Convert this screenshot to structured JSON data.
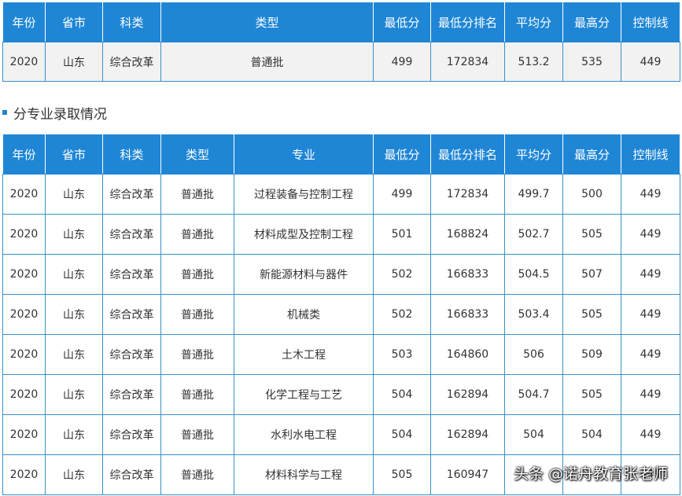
{
  "summary": {
    "headers": [
      "年份",
      "省市",
      "科类",
      "类型",
      "最低分",
      "最低分排名",
      "平均分",
      "最高分",
      "控制线"
    ],
    "row": [
      "2020",
      "山东",
      "综合改革",
      "普通批",
      "499",
      "172834",
      "513.2",
      "535",
      "449"
    ]
  },
  "section_title": "分专业录取情况",
  "majors": {
    "headers": [
      "年份",
      "省市",
      "科类",
      "类型",
      "专业",
      "最低分",
      "最低分排名",
      "平均分",
      "最高分",
      "控制线"
    ],
    "rows": [
      [
        "2020",
        "山东",
        "综合改革",
        "普通批",
        "过程装备与控制工程",
        "499",
        "172834",
        "499.7",
        "500",
        "449"
      ],
      [
        "2020",
        "山东",
        "综合改革",
        "普通批",
        "材料成型及控制工程",
        "501",
        "168824",
        "502.7",
        "505",
        "449"
      ],
      [
        "2020",
        "山东",
        "综合改革",
        "普通批",
        "新能源材料与器件",
        "502",
        "166833",
        "504.5",
        "507",
        "449"
      ],
      [
        "2020",
        "山东",
        "综合改革",
        "普通批",
        "机械类",
        "502",
        "166833",
        "503.4",
        "505",
        "449"
      ],
      [
        "2020",
        "山东",
        "综合改革",
        "普通批",
        "土木工程",
        "503",
        "164860",
        "506",
        "509",
        "449"
      ],
      [
        "2020",
        "山东",
        "综合改革",
        "普通批",
        "化学工程与工艺",
        "504",
        "162894",
        "504.7",
        "505",
        "449"
      ],
      [
        "2020",
        "山东",
        "综合改革",
        "普通批",
        "水利水电工程",
        "504",
        "162894",
        "504",
        "504",
        "449"
      ],
      [
        "2020",
        "山东",
        "综合改革",
        "普通批",
        "材料科学与工程",
        "505",
        "160947",
        "",
        "",
        "449"
      ]
    ]
  },
  "watermark": "头条 @诺舟教育张老师",
  "colors": {
    "header_bg": "#1f86d6",
    "border": "#3a8fc7",
    "summary_row_bg": "#f2f2f2"
  }
}
